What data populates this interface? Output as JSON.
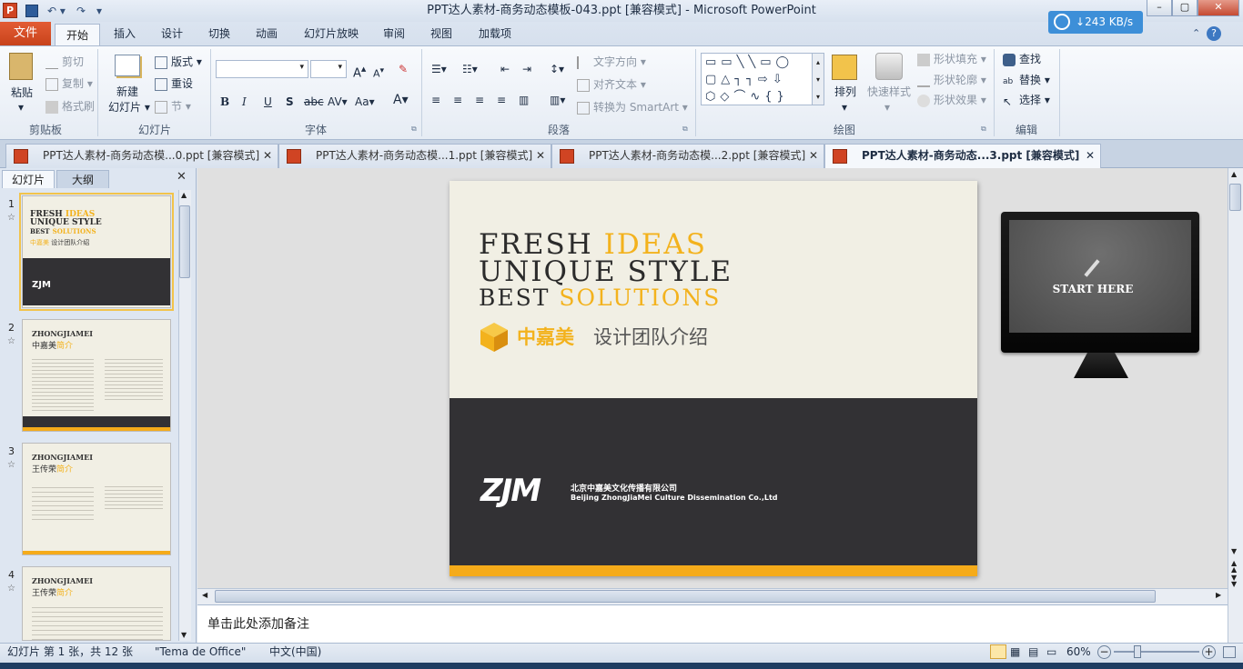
{
  "window": {
    "title": "PPT达人素材-商务动态模板-043.ppt [兼容模式]  -  Microsoft PowerPoint",
    "speed": "243 KB/s"
  },
  "ribbon_tabs": [
    "文件",
    "开始",
    "插入",
    "设计",
    "切换",
    "动画",
    "幻灯片放映",
    "审阅",
    "视图",
    "加载项"
  ],
  "clipboard": {
    "paste": "粘贴",
    "cut": "剪切",
    "copy": "复制",
    "format_painter": "格式刷",
    "label": "剪贴板"
  },
  "slides_group": {
    "new_slide": "新建",
    "new_slide2": "幻灯片",
    "layout": "版式",
    "reset": "重设",
    "section": "节",
    "label": "幻灯片"
  },
  "font_group": {
    "label": "字体",
    "bold": "B",
    "italic": "I",
    "underline": "U",
    "shadow": "S",
    "strike": "abc",
    "spacing": "AV",
    "case": "Aa",
    "color": "A",
    "grow": "A",
    "shrink": "A"
  },
  "paragraph_group": {
    "text_direction": "文字方向",
    "align_text": "对齐文本",
    "smartart": "转换为 SmartArt",
    "label": "段落"
  },
  "drawing_group": {
    "arrange": "排列",
    "quick_styles": "快速样式",
    "shape_fill": "形状填充",
    "shape_outline": "形状轮廓",
    "shape_effects": "形状效果",
    "label": "绘图"
  },
  "editing_group": {
    "find": "查找",
    "replace": "替换",
    "select": "选择",
    "label": "编辑"
  },
  "doc_tabs": [
    {
      "label": "PPT达人素材-商务动态模...0.ppt [兼容模式]"
    },
    {
      "label": "PPT达人素材-商务动态模...1.ppt [兼容模式]"
    },
    {
      "label": "PPT达人素材-商务动态模...2.ppt [兼容模式]"
    },
    {
      "label": "PPT达人素材-商务动态...3.ppt [兼容模式]"
    }
  ],
  "pane_tabs": {
    "slides": "幻灯片",
    "outline": "大纲"
  },
  "thumbnails": [
    {
      "num": "1",
      "line1": "FRESH",
      "line1b": "IDEAS",
      "line2": "UNIQUE STYLE",
      "line3": "BEST",
      "line3b": "SOLUTIONS",
      "brand": "中嘉美",
      "sub": "设计团队介绍"
    },
    {
      "num": "2",
      "title": "ZHONGJIAMEI",
      "sub": "中嘉美",
      "subb": "简介"
    },
    {
      "num": "3",
      "title": "ZHONGJIAMEI",
      "sub": "王传荣",
      "subb": "简介"
    },
    {
      "num": "4",
      "title": "ZHONGJIAMEI",
      "sub": "王传荣",
      "subb": "简介"
    }
  ],
  "slide": {
    "line1a": "FRESH",
    "line1b": "IDEAS",
    "line2": "UNIQUE STYLE",
    "line3a": "BEST",
    "line3b": "SOLUTIONS",
    "brand": "中嘉美",
    "brand_sub": "设计团队介绍",
    "logo": "ZJM",
    "company_cn": "北京中嘉美文化传播有限公司",
    "company_en": "Beijing ZhongJiaMei Culture Dissemination Co.,Ltd"
  },
  "monitor": {
    "label": "START HERE"
  },
  "notes": {
    "placeholder": "单击此处添加备注"
  },
  "status": {
    "slide_info": "幻灯片 第 1 张，共 12 张",
    "theme": "\"Tema de Office\"",
    "language": "中文(中国)",
    "zoom": "60%"
  },
  "colors": {
    "accent": "#f3b21d",
    "file_tab": "#d9502a",
    "slide_dark": "#323134"
  }
}
